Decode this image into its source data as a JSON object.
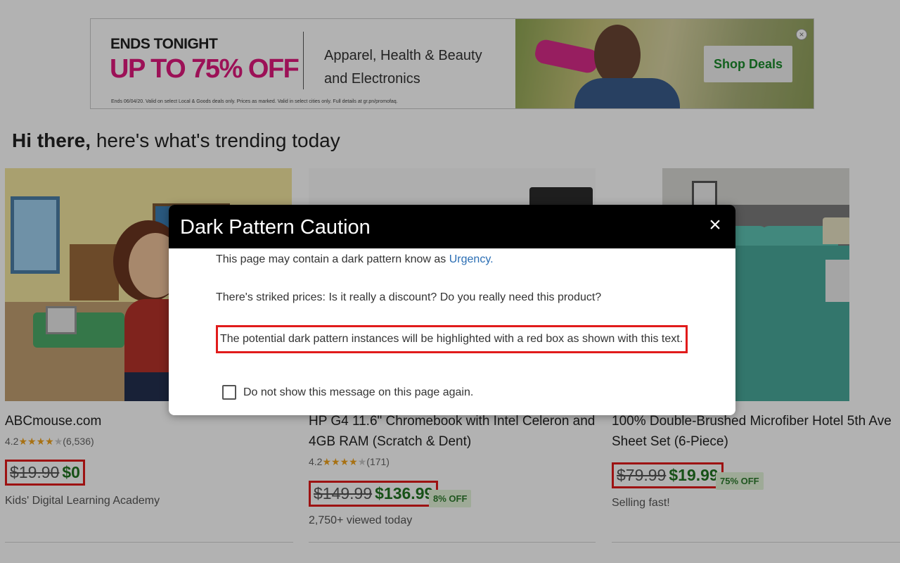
{
  "banner": {
    "headline1": "ENDS TONIGHT",
    "headline2": "UP TO 75% OFF",
    "categories_line1": "Apparel, Health & Beauty",
    "categories_line2": "and Electronics",
    "fine_print": "Ends 06/04/20. Valid on select Local & Goods deals only. Prices as marked. Valid in select cities only. Full details at gr.pn/promofaq.",
    "cta": "Shop Deals",
    "close": "×"
  },
  "greeting": {
    "bold": "Hi there,",
    "rest": "here's what's trending today"
  },
  "products": [
    {
      "title": "ABCmouse.com",
      "rating": "4.2",
      "stars_full": 4,
      "reviews": "(6,536)",
      "old_price": "$19.90",
      "new_price": "$0",
      "subtitle": "Kids' Digital Learning Academy"
    },
    {
      "title": "HP G4 11.6\" Chromebook with Intel Celeron and 4GB RAM (Scratch & Dent)",
      "rating": "4.2",
      "stars_full": 4,
      "reviews": "(171)",
      "old_price": "$149.99",
      "new_price": "$136.99",
      "discount": "8% OFF",
      "subtitle": "2,750+ viewed today"
    },
    {
      "title": "100% Double-Brushed Microfiber Hotel 5th Ave Sheet Set (6-Piece)",
      "old_price": "$79.99",
      "new_price": "$19.99",
      "discount": "75% OFF",
      "subtitle": "Selling fast!"
    }
  ],
  "modal": {
    "title": "Dark Pattern Caution",
    "close": "×",
    "line1_prefix": "This page may contain a dark pattern know as ",
    "line1_link": "Urgency.",
    "line2": "There's striked prices: Is it really a discount? Do you really need this product?",
    "highlight_text": "The potential dark pattern instances will be highlighted with a red box as shown with this text.",
    "checkbox_label": "Do not show this message on this page again.",
    "checkbox_checked": false
  },
  "colors": {
    "highlight_border": "#e11b1b",
    "price_green": "#227522",
    "link_blue": "#2a6db3",
    "banner_pink": "#e0197d"
  }
}
